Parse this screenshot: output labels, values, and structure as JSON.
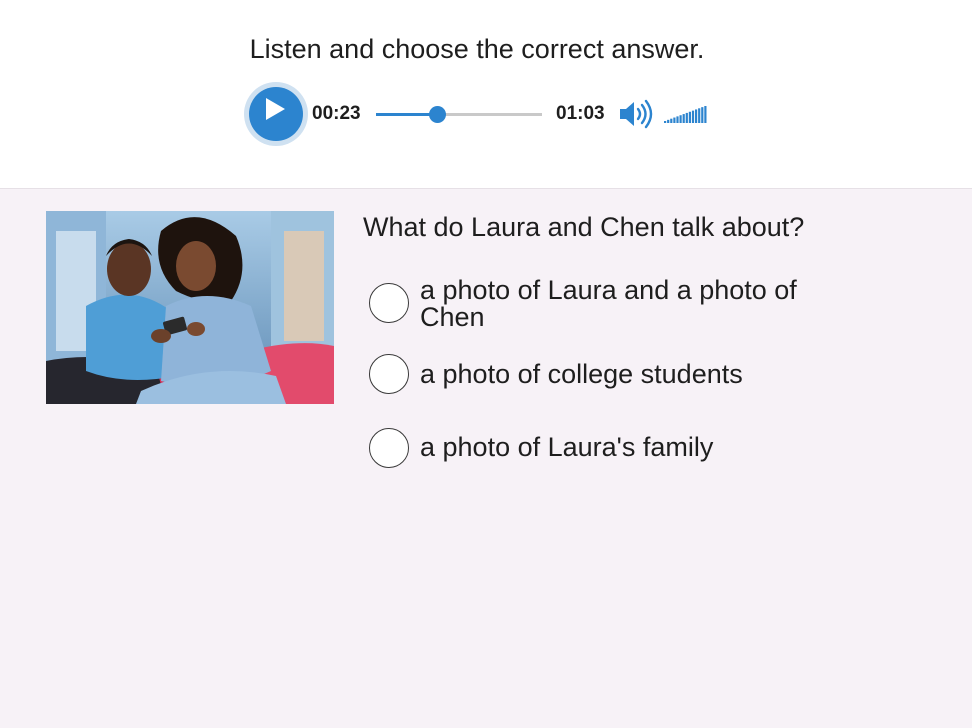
{
  "header": {
    "instruction": "Listen and choose the correct answer."
  },
  "audio_player": {
    "current_time": "00:23",
    "duration": "01:03",
    "progress": 0.37,
    "volume_level": 1.0,
    "play_icon": "play-icon",
    "speaker_icon": "speaker-icon",
    "volume_icon": "volume-bars-icon",
    "accent_color": "#2c84cf"
  },
  "question": {
    "text": "What do Laura and Chen talk about?",
    "options": [
      {
        "label": "a photo of Laura and a photo of Chen",
        "selected": false
      },
      {
        "label": "a photo of college students",
        "selected": false
      },
      {
        "label": "a photo of Laura's family",
        "selected": false
      }
    ]
  },
  "image": {
    "icon": "photo-two-people-looking-at-phone"
  }
}
